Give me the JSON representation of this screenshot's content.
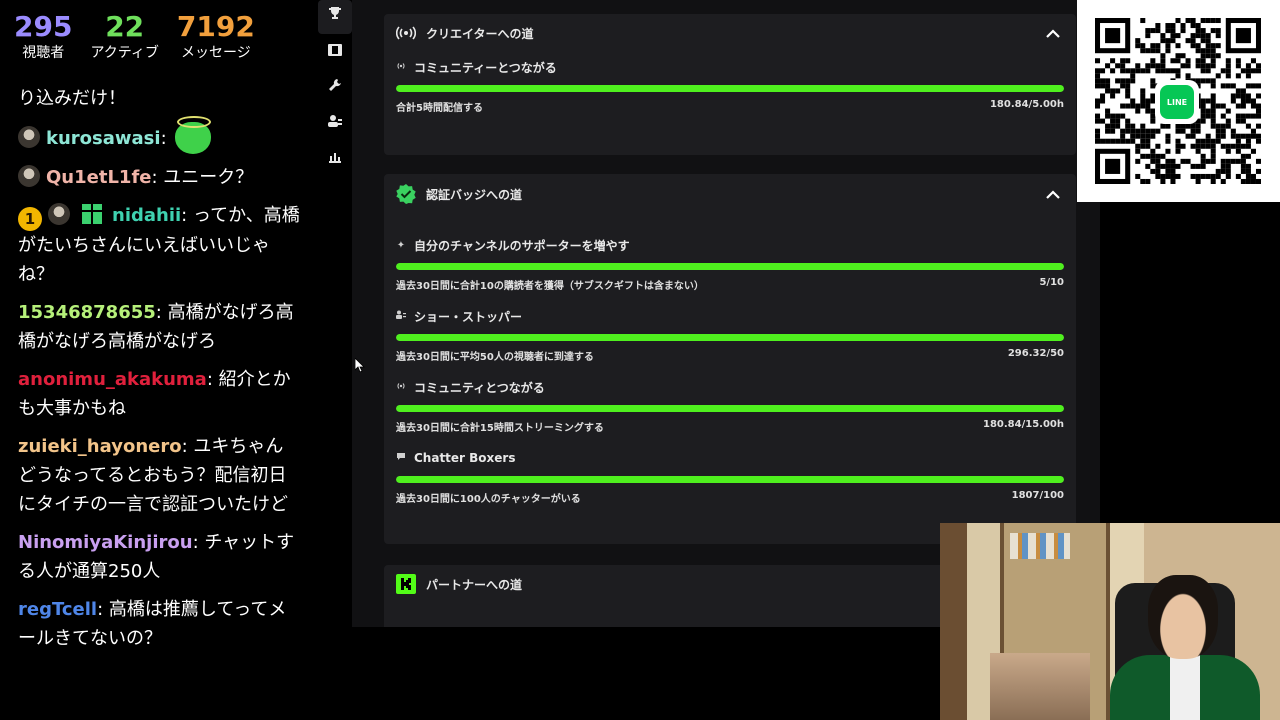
{
  "stats": [
    {
      "value": "295",
      "label": "視聴者",
      "color": "#9b8cff"
    },
    {
      "value": "22",
      "label": "アクティブ",
      "color": "#6fe05c"
    },
    {
      "value": "7192",
      "label": "メッセージ",
      "color": "#f2a03d"
    }
  ],
  "chat": [
    {
      "user": "",
      "color": "#ffffff",
      "text": "り込みだけ！"
    },
    {
      "user": "kurosawasi",
      "color": "#8ee6d6",
      "text": ""
    },
    {
      "user": "Qu1etL1fe",
      "color": "#f0b4a8",
      "text": "ユニーク？"
    },
    {
      "user": "nidahii",
      "color": "#3fd1b0",
      "text": "ってか、高橋がたいちさんにいえばいいじゃね？"
    },
    {
      "user": "15346878655",
      "color": "#b6f07a",
      "text": "高橋がなげろ高橋がなげろ高橋がなげろ"
    },
    {
      "user": "anonimu_akakuma",
      "color": "#e0203c",
      "text": "紹介とかも大事かもね"
    },
    {
      "user": "zuieki_hayonero",
      "color": "#f2c48a",
      "text": "ユキちゃんどうなってるとおもう？配信初日にタイチの一言で認証ついたけど"
    },
    {
      "user": "NinomiyaKinjirou",
      "color": "#c9a0f0",
      "text": "チャットする人が通算250人"
    },
    {
      "user": "regTcell",
      "color": "#4f86e8",
      "text": "高橋は推薦してってメールきてないの？"
    }
  ],
  "rail": [
    "trophy-icon",
    "film-icon",
    "wrench-icon",
    "users-icon",
    "chart-icon"
  ],
  "cards": {
    "creator": {
      "title": "クリエイターへの道",
      "items": [
        {
          "title": "コミュニティーとつながる",
          "icon": "broadcast-icon",
          "desc": "合計5時間配信する",
          "value": "180.84/5.00h",
          "progress": 1.0
        }
      ]
    },
    "verified": {
      "title": "認証バッジへの道",
      "items": [
        {
          "title": "自分のチャンネルのサポーターを増やす",
          "icon": "sparkle-icon",
          "desc": "過去30日間に合計10の購読者を獲得（サブスクギフトは含まない）",
          "value": "5/10",
          "progress": 1.0
        },
        {
          "title": "ショー・ストッパー",
          "icon": "people-icon",
          "desc": "過去30日間に平均50人の視聴者に到達する",
          "value": "296.32/50",
          "progress": 1.0
        },
        {
          "title": "コミュニティとつながる",
          "icon": "broadcast-icon",
          "desc": "過去30日間に合計15時間ストリーミングする",
          "value": "180.84/15.00h",
          "progress": 1.0
        },
        {
          "title": "Chatter Boxers",
          "icon": "chat-bubble-icon",
          "desc": "過去30日間に100人のチャッターがいる",
          "value": "1807/100",
          "progress": 1.0
        }
      ]
    },
    "partner": {
      "title": "パートナーへの道"
    }
  },
  "qr": {
    "badge": "LINE"
  }
}
